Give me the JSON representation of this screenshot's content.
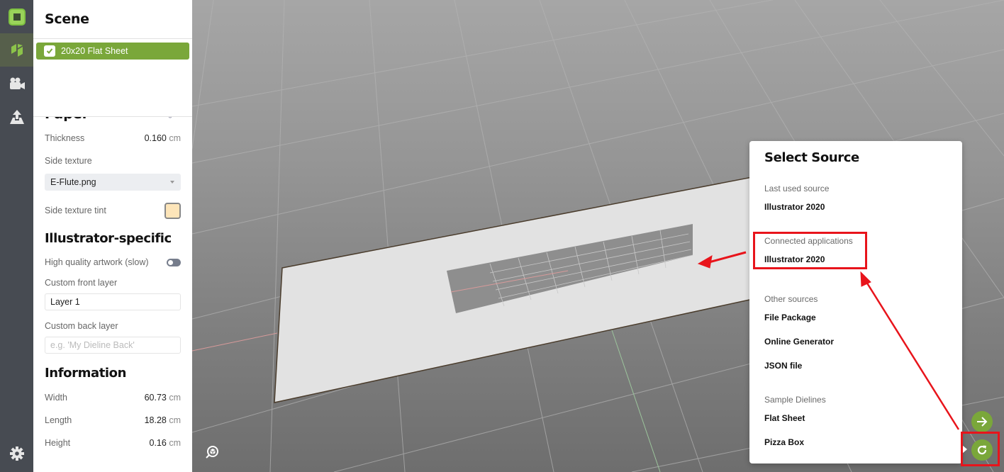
{
  "rail": {
    "items": [
      {
        "name": "logo",
        "icon": "app-logo-icon"
      },
      {
        "name": "scene",
        "icon": "dieline-icon",
        "active": true
      },
      {
        "name": "camera",
        "icon": "video-camera-icon"
      },
      {
        "name": "export",
        "icon": "upload-icon"
      },
      {
        "name": "settings",
        "icon": "gear-icon"
      }
    ]
  },
  "panel": {
    "title": "Scene",
    "scene_item": {
      "label": "20x20 Flat Sheet",
      "checked": true
    },
    "paper": {
      "title": "Paper",
      "thickness_label": "Thickness",
      "thickness_value": "0.160",
      "thickness_unit": "cm",
      "side_texture_label": "Side texture",
      "side_texture_value": "E-Flute.png",
      "side_texture_tint_label": "Side texture tint",
      "side_texture_tint_color": "#fde5b9"
    },
    "illustrator": {
      "title": "Illustrator-specific",
      "hq_label": "High quality artwork (slow)",
      "hq_enabled": false,
      "front_layer_label": "Custom front layer",
      "front_layer_value": "Layer 1",
      "back_layer_label": "Custom back layer",
      "back_layer_placeholder": "e.g. 'My Dieline Back'"
    },
    "information": {
      "title": "Information",
      "rows": [
        {
          "label": "Width",
          "value": "60.73",
          "unit": "cm"
        },
        {
          "label": "Length",
          "value": "18.28",
          "unit": "cm"
        },
        {
          "label": "Height",
          "value": "0.16",
          "unit": "cm"
        }
      ]
    }
  },
  "popover": {
    "title": "Select Source",
    "last_used": {
      "category": "Last used source",
      "item": "Illustrator 2020"
    },
    "connected": {
      "category": "Connected applications",
      "item": "Illustrator 2020"
    },
    "other": {
      "category": "Other sources",
      "items": [
        "File Package",
        "Online Generator",
        "JSON file"
      ]
    },
    "samples": {
      "category": "Sample Dielines",
      "items": [
        "Flat Sheet",
        "Pizza Box"
      ]
    }
  },
  "colors": {
    "accent_green": "#7aa73a",
    "rail_bg": "#474b52",
    "annotation_red": "#e8141b"
  }
}
